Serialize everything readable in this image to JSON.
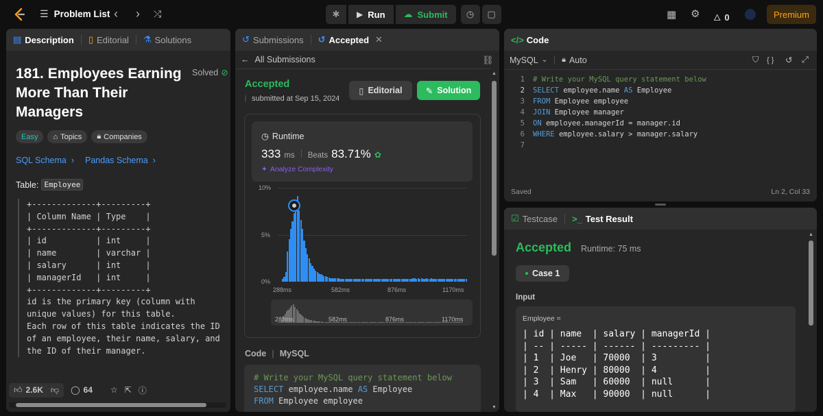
{
  "topbar": {
    "problem_list": "Problem List",
    "run": "Run",
    "submit": "Submit",
    "fire_count": "0",
    "premium": "Premium"
  },
  "left": {
    "tabs": [
      "Description",
      "Editorial",
      "Solutions"
    ],
    "title": "181. Employees Earning More Than Their Managers",
    "solved": "Solved",
    "badges": {
      "difficulty": "Easy",
      "topics": "Topics",
      "companies": "Companies"
    },
    "schema_links": [
      "SQL Schema",
      "Pandas Schema"
    ],
    "table_label": "Table:",
    "table_name": "Employee",
    "schema_block": "+-------------+---------+\n| Column Name | Type    |\n+-------------+---------+\n| id          | int     |\n| name        | varchar |\n| salary      | int     |\n| managerId   | int     |\n+-------------+---------+\nid is the primary key (column with\nunique values) for this table.\nEach row of this table indicates the ID\nof an employee, their name, salary, and\nthe ID of their manager.",
    "footer": {
      "likes": "2.6K",
      "comments": "64"
    }
  },
  "middle": {
    "tabs": [
      "Submissions",
      "Accepted"
    ],
    "back": "All Submissions",
    "status": "Accepted",
    "submitted": "submitted at Sep 15, 2024",
    "editorial_btn": "Editorial",
    "solution_btn": "Solution",
    "runtime_label": "Runtime",
    "runtime_value": "333",
    "runtime_unit": "ms",
    "beats_label": "Beats",
    "beats_value": "83.71%",
    "analyze": "Analyze Complexity",
    "code_label": "Code",
    "code_lang": "MySQL",
    "code_preview": [
      {
        "cls": "cm",
        "text": "# Write your MySQL query statement below"
      },
      {
        "cls": "",
        "kw": "SELECT",
        "text": " employee.name ",
        "kw2": "AS",
        "text2": " Employee"
      },
      {
        "cls": "",
        "kw": "FROM",
        "text": " Employee employee"
      }
    ]
  },
  "chart_data": {
    "type": "bar",
    "y_ticks": [
      "10%",
      "5%",
      "0%"
    ],
    "ylim": [
      0,
      10
    ],
    "x_ticks": [
      "288ms",
      "582ms",
      "876ms",
      "1170ms"
    ],
    "values": [
      0.3,
      0.5,
      1.0,
      3.2,
      4.5,
      5.6,
      6.4,
      7.3,
      8.2,
      9.1,
      7.6,
      6.6,
      5.6,
      4.4,
      3.6,
      2.9,
      2.5,
      2.0,
      1.7,
      1.4,
      1.2,
      1.0,
      0.9,
      0.8,
      0.7,
      0.6,
      0.55,
      0.5,
      0.45,
      0.4,
      0.38,
      0.36,
      0.35,
      0.34,
      0.33,
      0.32,
      0.32,
      0.31,
      0.3,
      0.3,
      0.3,
      0.3,
      0.3,
      0.3,
      0.3,
      0.3,
      0.3,
      0.3,
      0.3,
      0.3,
      0.3,
      0.3,
      0.3,
      0.3,
      0.3,
      0.3,
      0.3,
      0.3,
      0.3,
      0.3,
      0.3,
      0.3,
      0.3,
      0.3,
      0.3,
      0.3,
      0.3,
      0.3,
      0.3,
      0.3,
      0.3,
      0.3,
      0.3,
      0.3,
      0.3,
      0.3,
      0.3,
      0.3,
      0.3,
      0.35,
      0.35,
      0.3,
      0.35,
      0.3,
      0.35,
      0.3,
      0.3,
      0.35,
      0.3,
      0.3,
      0.35,
      0.3,
      0.3,
      0.3,
      0.3,
      0.3,
      0.3,
      0.3,
      0.3,
      0.3,
      0.3,
      0.3,
      0.3,
      0.3,
      0.3,
      0.3,
      0.3,
      0.3,
      0.3,
      0.3,
      0.3,
      0.3
    ],
    "marker_index": 7,
    "bar_color": "#2f8ef3"
  },
  "editor": {
    "title": "Code",
    "lang": "MySQL",
    "auto": "Auto",
    "lines": [
      "# Write your MySQL query statement below",
      "SELECT employee.name AS Employee",
      "FROM Employee employee",
      "JOIN Employee manager",
      "ON employee.managerId = manager.id",
      "WHERE employee.salary > manager.salary",
      ""
    ],
    "saved": "Saved",
    "cursor": "Ln 2, Col 33"
  },
  "result": {
    "tabs": [
      "Testcase",
      "Test Result"
    ],
    "status": "Accepted",
    "runtime": "Runtime: 75 ms",
    "case": "Case 1",
    "input_label": "Input",
    "var_name": "Employee =",
    "table": "| id | name  | salary | managerId |\n| -- | ----- | ------ | --------- |\n| 1  | Joe   | 70000  | 3         |\n| 2  | Henry | 80000  | 4         |\n| 3  | Sam   | 60000  | null      |\n| 4  | Max   | 90000  | null      |"
  },
  "colors": {
    "accent_green": "#2cbb5d",
    "premium": "#ffa116"
  }
}
